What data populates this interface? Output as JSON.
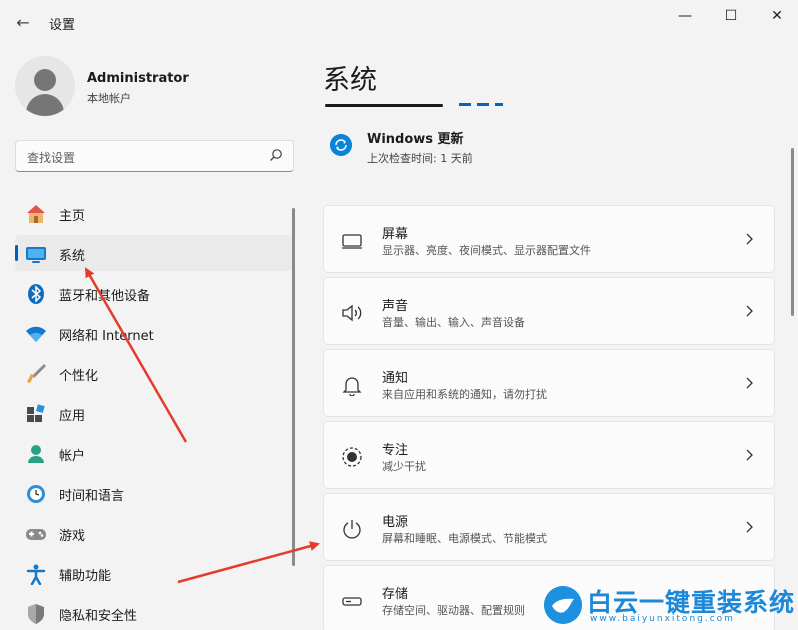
{
  "window": {
    "title": "设置",
    "back_glyph": "←",
    "minimize_glyph": "—",
    "maximize_glyph": "☐",
    "close_glyph": "✕"
  },
  "profile": {
    "name": "Administrator",
    "account_type": "本地帐户"
  },
  "search": {
    "placeholder": "查找设置"
  },
  "sidebar": {
    "items": [
      {
        "label": "主页",
        "icon": "home-icon"
      },
      {
        "label": "系统",
        "icon": "system-icon",
        "active": true
      },
      {
        "label": "蓝牙和其他设备",
        "icon": "bluetooth-icon"
      },
      {
        "label": "网络和 Internet",
        "icon": "wifi-icon"
      },
      {
        "label": "个性化",
        "icon": "brush-icon"
      },
      {
        "label": "应用",
        "icon": "apps-icon"
      },
      {
        "label": "帐户",
        "icon": "account-icon"
      },
      {
        "label": "时间和语言",
        "icon": "clock-globe-icon"
      },
      {
        "label": "游戏",
        "icon": "gamepad-icon"
      },
      {
        "label": "辅助功能",
        "icon": "accessibility-icon"
      },
      {
        "label": "隐私和安全性",
        "icon": "shield-icon"
      }
    ]
  },
  "main": {
    "title": "系统",
    "update": {
      "title": "Windows 更新",
      "subtitle": "上次检查时间: 1 天前"
    },
    "cards": [
      {
        "title": "屏幕",
        "subtitle": "显示器、亮度、夜间模式、显示器配置文件",
        "icon": "display-icon"
      },
      {
        "title": "声音",
        "subtitle": "音量、输出、输入、声音设备",
        "icon": "speaker-icon"
      },
      {
        "title": "通知",
        "subtitle": "来自应用和系统的通知，请勿打扰",
        "icon": "bell-icon"
      },
      {
        "title": "专注",
        "subtitle": "减少干扰",
        "icon": "focus-icon"
      },
      {
        "title": "电源",
        "subtitle": "屏幕和睡眠、电源模式、节能模式",
        "icon": "power-icon"
      },
      {
        "title": "存储",
        "subtitle": "存储空间、驱动器、配置规则",
        "icon": "storage-icon"
      }
    ]
  },
  "watermark": {
    "text": "白云一键重装系统",
    "url": "www.baiyunxitong.com"
  },
  "colors": {
    "accent": "#005fb8",
    "annotation_arrow": "#e53b2c",
    "watermark": "#1e88d8"
  }
}
